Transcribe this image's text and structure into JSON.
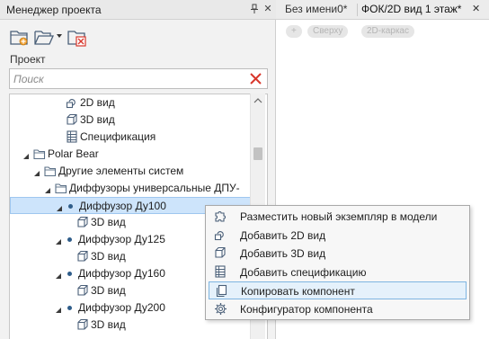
{
  "panel": {
    "title": "Менеджер проекта",
    "pin_glyph": "ᵖ",
    "close_glyph": "✕",
    "toolbar": {
      "new_icon": "new-folder-icon",
      "open_icon": "open-folder-icon",
      "dropdown_icon": "dropdown-arrow-icon",
      "delete_icon": "delete-folder-icon"
    },
    "section_label": "Проект",
    "search": {
      "placeholder": "Поиск",
      "value": "",
      "clear_icon": "clear-x-icon"
    }
  },
  "tree": [
    {
      "label": "2D вид",
      "icon": "view2d-icon",
      "level": 4,
      "expander": "none"
    },
    {
      "label": "3D вид",
      "icon": "view3d-icon",
      "level": 4,
      "expander": "none"
    },
    {
      "label": "Спецификация",
      "icon": "spec-icon",
      "level": 4,
      "expander": "none"
    },
    {
      "label": "Polar Bear",
      "icon": "folder-icon",
      "level": 1,
      "expander": "expanded"
    },
    {
      "label": "Другие элементы систем",
      "icon": "folder-icon",
      "level": 2,
      "expander": "expanded"
    },
    {
      "label": "Диффузоры универсальные ДПУ-",
      "icon": "folder-icon",
      "level": 3,
      "expander": "expanded"
    },
    {
      "label": "Диффузор Ду100",
      "icon": "component-dot",
      "level": 4,
      "expander": "expanded",
      "selected": true
    },
    {
      "label": "3D вид",
      "icon": "view3d-icon",
      "level": 5,
      "expander": "none"
    },
    {
      "label": "Диффузор Ду125",
      "icon": "component-dot",
      "level": 4,
      "expander": "expanded"
    },
    {
      "label": "3D вид",
      "icon": "view3d-icon",
      "level": 5,
      "expander": "none"
    },
    {
      "label": "Диффузор Ду160",
      "icon": "component-dot",
      "level": 4,
      "expander": "expanded"
    },
    {
      "label": "3D вид",
      "icon": "view3d-icon",
      "level": 5,
      "expander": "none"
    },
    {
      "label": "Диффузор Ду200",
      "icon": "component-dot",
      "level": 4,
      "expander": "expanded"
    },
    {
      "label": "3D вид",
      "icon": "view3d-icon",
      "level": 5,
      "expander": "none"
    }
  ],
  "tabs": [
    {
      "label": "Без имени0*"
    },
    {
      "label": "ФОК/2D вид 1 этаж*",
      "close_glyph": "✕",
      "active": true
    }
  ],
  "view_pills": [
    "+",
    "Сверху",
    "2D-каркас"
  ],
  "context_menu": [
    {
      "label": "Разместить новый экземпляр в модели",
      "icon": "puzzle-icon"
    },
    {
      "label": "Добавить 2D вид",
      "icon": "view2d-icon"
    },
    {
      "label": "Добавить 3D вид",
      "icon": "view3d-icon"
    },
    {
      "label": "Добавить спецификацию",
      "icon": "spec-icon"
    },
    {
      "label": "Копировать компонент",
      "icon": "copy-icon",
      "highlighted": true
    },
    {
      "label": "Конфигуратор компонента",
      "icon": "gear-icon"
    }
  ],
  "colors": {
    "selection": "#cde4fb",
    "menu_highlight": "#e5f1fb",
    "menu_highlight_border": "#7fb5e1",
    "folder": "#5a6f86",
    "delete_red": "#d8372c"
  }
}
